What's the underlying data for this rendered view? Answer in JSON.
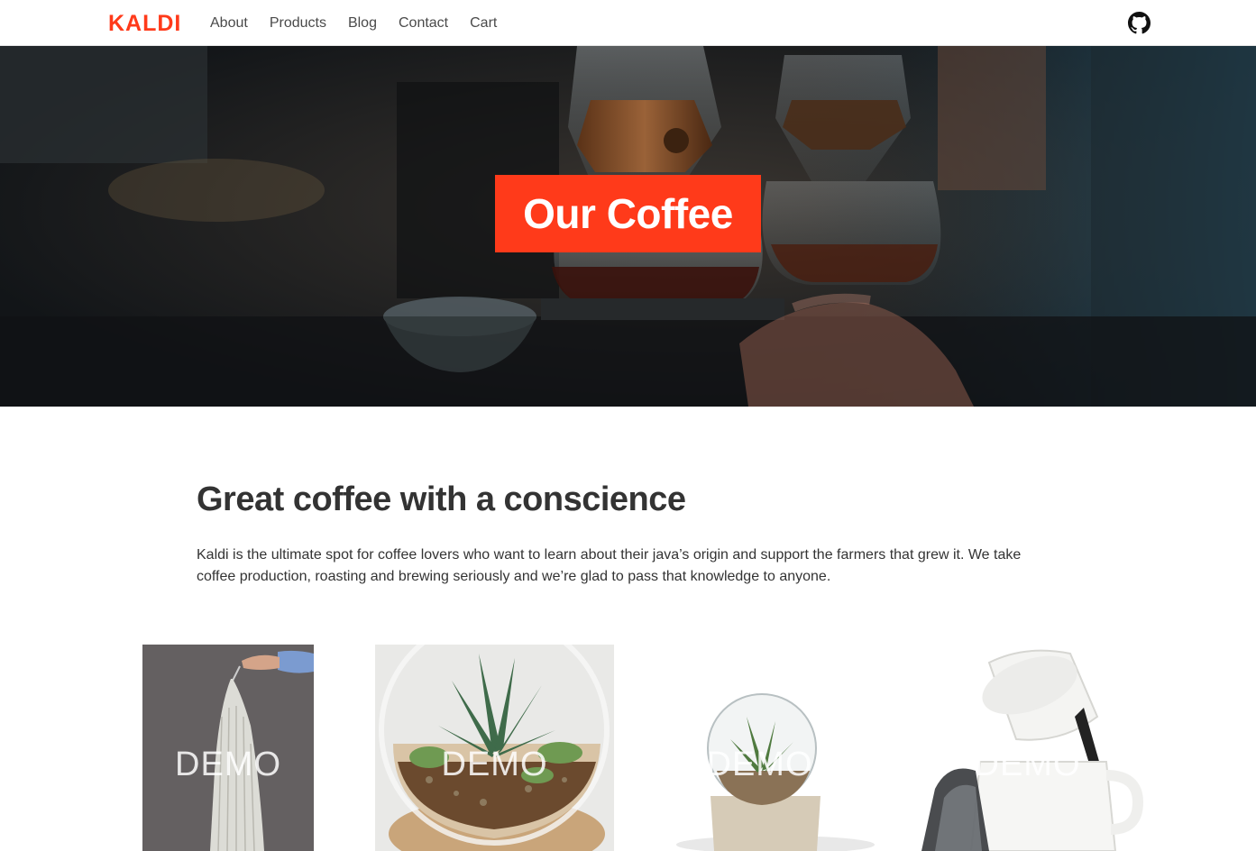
{
  "navbar": {
    "logo_text": "KALDI",
    "items": [
      {
        "label": "About"
      },
      {
        "label": "Products"
      },
      {
        "label": "Blog"
      },
      {
        "label": "Contact"
      },
      {
        "label": "Cart"
      }
    ],
    "github_icon": "github-icon"
  },
  "hero": {
    "title": "Our Coffee"
  },
  "intro": {
    "heading": "Great coffee with a conscience",
    "description": "Kaldi is the ultimate spot for coffee lovers who want to learn about their java’s origin and support the farmers that grew it. We take coffee production, roasting and brewing seriously and we’re glad to pass that knowledge to anyone."
  },
  "products": [
    {
      "label": "DEMO"
    },
    {
      "label": "DEMO"
    },
    {
      "label": "DEMO"
    },
    {
      "label": "DEMO"
    }
  ],
  "colors": {
    "accent": "#ff3a1a",
    "text": "#333333"
  }
}
